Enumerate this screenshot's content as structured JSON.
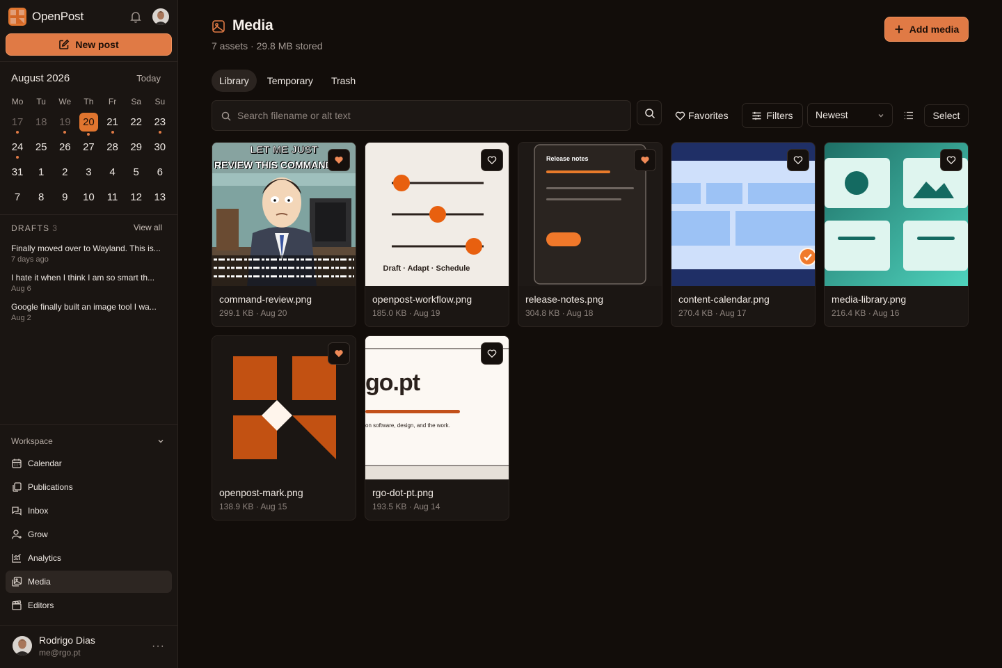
{
  "app": {
    "name": "OpenPost",
    "new_post_label": "New post"
  },
  "calendar": {
    "month_label": "August 2026",
    "today_label": "Today",
    "weekdays": [
      "Mo",
      "Tu",
      "We",
      "Th",
      "Fr",
      "Sa",
      "Su"
    ],
    "weeks": [
      [
        {
          "d": "17",
          "muted": true,
          "dot": true
        },
        {
          "d": "18",
          "muted": true
        },
        {
          "d": "19",
          "muted": true,
          "dot": true
        },
        {
          "d": "20",
          "selected": true,
          "dot": true
        },
        {
          "d": "21",
          "dot": true
        },
        {
          "d": "22"
        },
        {
          "d": "23",
          "dot": true
        }
      ],
      [
        {
          "d": "24",
          "dot": true
        },
        {
          "d": "25"
        },
        {
          "d": "26"
        },
        {
          "d": "27"
        },
        {
          "d": "28"
        },
        {
          "d": "29"
        },
        {
          "d": "30"
        }
      ],
      [
        {
          "d": "31"
        },
        {
          "d": "1"
        },
        {
          "d": "2"
        },
        {
          "d": "3"
        },
        {
          "d": "4"
        },
        {
          "d": "5"
        },
        {
          "d": "6"
        }
      ],
      [
        {
          "d": "7"
        },
        {
          "d": "8"
        },
        {
          "d": "9"
        },
        {
          "d": "10"
        },
        {
          "d": "11"
        },
        {
          "d": "12"
        },
        {
          "d": "13"
        }
      ]
    ]
  },
  "drafts": {
    "label": "DRAFTS",
    "count": "3",
    "view_all": "View all",
    "items": [
      {
        "title": "Finally moved over to Wayland. This is...",
        "date": "7 days ago"
      },
      {
        "title": "I hate it when I think I am so smart th...",
        "date": "Aug 6"
      },
      {
        "title": "Google finally built an image tool I wa...",
        "date": "Aug 2"
      }
    ]
  },
  "workspace": {
    "label": "Workspace",
    "items": [
      {
        "label": "Calendar",
        "icon": "calendar-icon"
      },
      {
        "label": "Publications",
        "icon": "copy-icon"
      },
      {
        "label": "Inbox",
        "icon": "messages-icon"
      },
      {
        "label": "Grow",
        "icon": "user-plus-icon"
      },
      {
        "label": "Analytics",
        "icon": "chart-icon"
      },
      {
        "label": "Media",
        "icon": "images-icon",
        "active": true
      },
      {
        "label": "Editors",
        "icon": "clapperboard-icon"
      }
    ]
  },
  "user": {
    "name": "Rodrigo Dias",
    "email": "me@rgo.pt"
  },
  "header": {
    "title": "Media",
    "subtitle": "7 assets · 29.8 MB stored",
    "add_label": "Add media"
  },
  "tabs": [
    {
      "label": "Library",
      "active": true
    },
    {
      "label": "Temporary"
    },
    {
      "label": "Trash"
    }
  ],
  "toolbar": {
    "search_placeholder": "Search filename or alt text",
    "favorites_label": "Favorites",
    "filters_label": "Filters",
    "sort_value": "Newest",
    "select_label": "Select"
  },
  "media": [
    {
      "name": "command-review.png",
      "meta": "299.1 KB · Aug 20",
      "favorite": true,
      "thumb": "meme",
      "thumb_text": [
        "LET ME JUST",
        "REVIEW THIS COMMAND"
      ]
    },
    {
      "name": "openpost-workflow.png",
      "meta": "185.0 KB · Aug 19",
      "favorite": false,
      "thumb": "sliders",
      "thumb_text": [
        "Draft · Adapt · Schedule"
      ]
    },
    {
      "name": "release-notes.png",
      "meta": "304.8 KB · Aug 18",
      "favorite": true,
      "thumb": "phone",
      "thumb_text": [
        "Release notes"
      ]
    },
    {
      "name": "content-calendar.png",
      "meta": "270.4 KB · Aug 17",
      "favorite": false,
      "selected": true,
      "thumb": "calendar",
      "thumb_text": []
    },
    {
      "name": "media-library.png",
      "meta": "216.4 KB · Aug 16",
      "favorite": false,
      "thumb": "library",
      "thumb_text": []
    },
    {
      "name": "openpost-mark.png",
      "meta": "138.9 KB · Aug 15",
      "favorite": true,
      "thumb": "mark",
      "thumb_text": []
    },
    {
      "name": "rgo-dot-pt.png",
      "meta": "193.5 KB · Aug 14",
      "favorite": false,
      "thumb": "site",
      "thumb_text": [
        "go.pt",
        "on software, design, and the work."
      ]
    }
  ],
  "colors": {
    "accent": "#e07a45",
    "background": "#120d0a",
    "sidebar": "#1a1512",
    "heart": "#f08a57"
  }
}
